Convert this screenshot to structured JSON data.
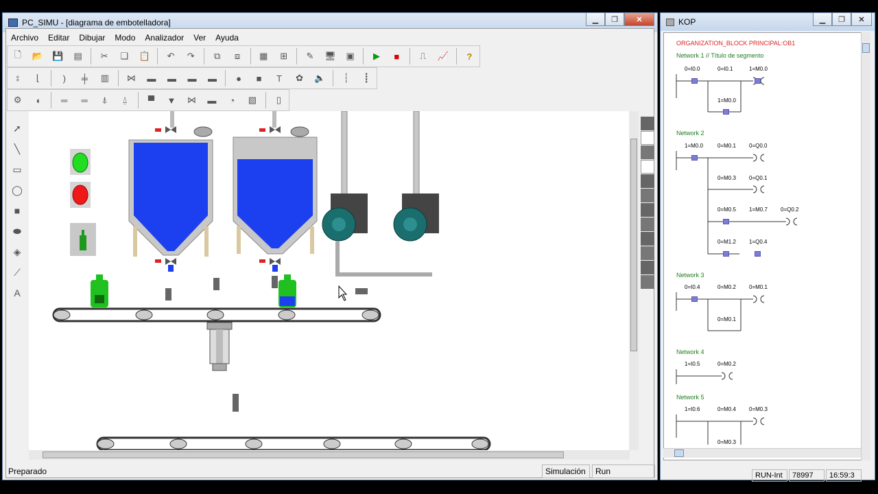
{
  "main_window": {
    "title": "PC_SIMU - [diagrama de embotelladora]",
    "menu": [
      "Archivo",
      "Editar",
      "Dibujar",
      "Modo",
      "Analizador",
      "Ver",
      "Ayuda"
    ],
    "status_left": "Preparado",
    "status_mode": "Simulación",
    "status_state": "Run"
  },
  "kop_window": {
    "title": "KOP",
    "block_title": "ORGANIZATION_BLOCK PRINCIPAL:OB1",
    "networks": [
      {
        "label": "Network 1 // Título de segmento",
        "contacts": [
          "0=I0.0",
          "0=I0.1",
          "1=M0.0",
          "1=M0.0"
        ]
      },
      {
        "label": "Network 2",
        "contacts": [
          "1=M0.0",
          "0=M0.1",
          "0=Q0.0",
          "0=M0.3",
          "0=Q0.1",
          "0=M0.5",
          "1=M0.7",
          "0=Q0.2",
          "0=M1.2",
          "1=Q0.4"
        ]
      },
      {
        "label": "Network 3",
        "contacts": [
          "0=I0.4",
          "0=M0.2",
          "0=M0.1",
          "0=M0.1"
        ]
      },
      {
        "label": "Network 4",
        "contacts": [
          "1=I0.5",
          "0=M0.2"
        ]
      },
      {
        "label": "Network 5",
        "contacts": [
          "1=I0.6",
          "0=M0.4",
          "0=M0.3",
          "0=M0.3"
        ]
      }
    ],
    "status": {
      "run": "RUN-Int",
      "count": "78997",
      "time": "16:59:3"
    }
  },
  "colors": {
    "accent_blue": "#1c3ff0",
    "liquid": "#1c3ff0",
    "bottle_green": "#1fc01f",
    "lamp_green": "#22dd22",
    "lamp_red": "#ee1a1a",
    "contact": "#7d7dd8"
  }
}
